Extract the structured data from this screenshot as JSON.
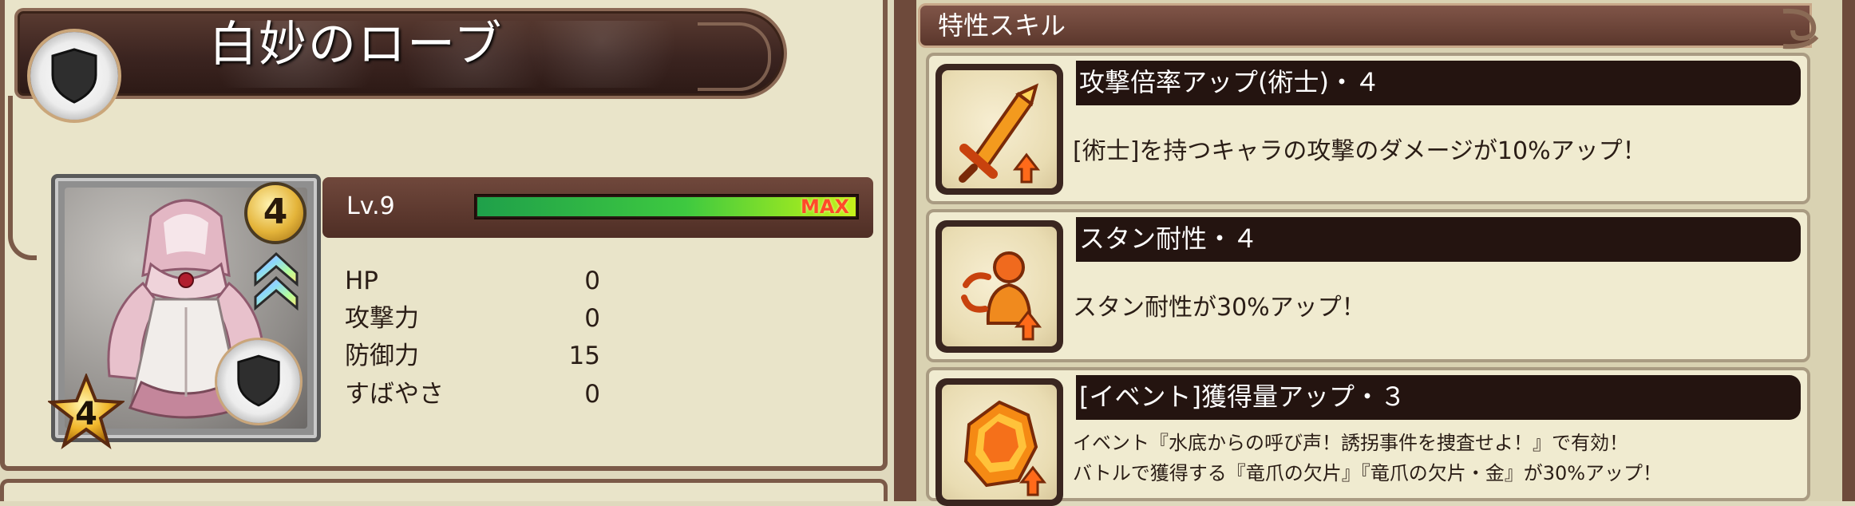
{
  "item": {
    "name": "白妙のローブ",
    "category_icon": "shield-icon",
    "rarity": "4",
    "stars": "4",
    "rank_icon": "rank-up-chevron-icon"
  },
  "level": {
    "label": "Lv.9",
    "max_label": "MAX",
    "exp_fraction": 1.0
  },
  "stats": [
    {
      "label": "HP",
      "value": "0"
    },
    {
      "label": "攻撃力",
      "value": "0"
    },
    {
      "label": "防御力",
      "value": "15"
    },
    {
      "label": "すばやさ",
      "value": "0"
    }
  ],
  "skills_section": {
    "title": "特性スキル"
  },
  "skills": [
    {
      "name": "攻撃倍率アップ(術士)・４",
      "icon": "sword-up-icon",
      "description": [
        "[術士]を持つキャラの攻撃のダメージが10%アップ！"
      ]
    },
    {
      "name": "スタン耐性・４",
      "icon": "stun-resist-icon",
      "description": [
        "スタン耐性が30%アップ！"
      ]
    },
    {
      "name": "[イベント]獲得量アップ・３",
      "icon": "gem-up-icon",
      "description": [
        "イベント『水底からの呼び声！誘拐事件を捜査せよ！』で有効！",
        "バトルで獲得する『竜爪の欠片』『竜爪の欠片・金』が30%アップ！"
      ]
    }
  ],
  "colors": {
    "panel_border": "#7b5a48",
    "banner": "#3b2420",
    "exp_green": "#3ec940",
    "max_red": "#ff4a2a"
  }
}
